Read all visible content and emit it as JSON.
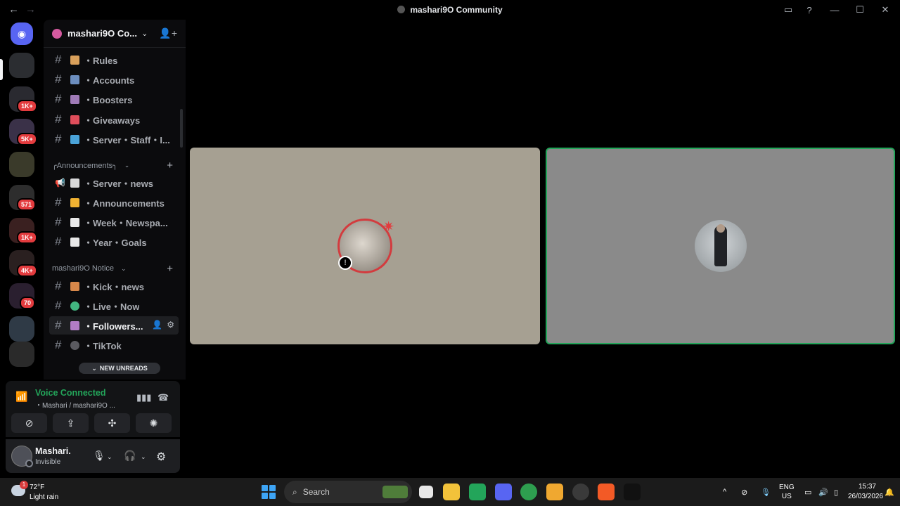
{
  "window": {
    "title": "mashari9O Community",
    "back_icon": "←",
    "forward_icon": "→"
  },
  "rail": {
    "badges": [
      "1K+",
      "5K+",
      "571",
      "1K+",
      "4K+",
      "70"
    ]
  },
  "server": {
    "name": "mashari9O Co...",
    "channels_top": [
      {
        "label": "・Rules",
        "color": "#d9a05b"
      },
      {
        "label": "・Accounts",
        "color": "#6c8ebf"
      },
      {
        "label": "・Boosters",
        "color": "#a07bb8"
      },
      {
        "label": "・Giveaways",
        "color": "#e04e5b"
      },
      {
        "label": "・Server・Staff・I...",
        "color": "#4aa3d8"
      }
    ],
    "category_announcements": "╭Announcements╮",
    "channels_announcements": [
      {
        "label": "・Server・news",
        "color": "#d8d8d8"
      },
      {
        "label": "・Announcements",
        "color": "#f0b232"
      },
      {
        "label": "・Week・Newspa...",
        "color": "#e8e8e8"
      },
      {
        "label": "・Year・Goals",
        "color": "#e8e8e8"
      }
    ],
    "category_notice": "mashari9O Notice",
    "channels_notice": [
      {
        "label": "・Kick・news",
        "color": "#d8884a"
      },
      {
        "label": "・Live・Now",
        "color": "#43b581"
      },
      {
        "label": "・Followers...",
        "color": "#b27cc6"
      },
      {
        "label": "・TikTok",
        "color": "#5a5a60"
      }
    ],
    "new_unreads": "NEW UNREADS"
  },
  "voice": {
    "status": "Voice Connected",
    "channel": "・Mashari / mashari9O ..."
  },
  "user": {
    "name": "Mashari.",
    "status": "Invisible"
  },
  "taskbar": {
    "weather_temp": "72°F",
    "weather_desc": "Light rain",
    "weather_badge": "1",
    "search_placeholder": "Search",
    "lang_top": "ENG",
    "lang_bottom": "US",
    "time": "15:37",
    "date": "26/03/2026"
  },
  "colors": {
    "speaking_border": "#23a55a",
    "voice_green": "#23a55a",
    "badge_red": "#e33b3e"
  }
}
